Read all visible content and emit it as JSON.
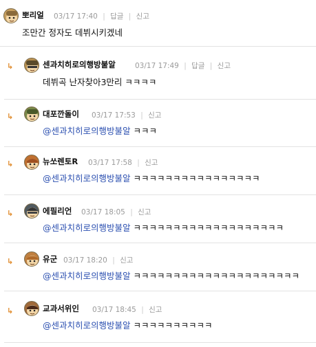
{
  "comments": [
    {
      "author": "뽀리얼",
      "time": "03/17 17:40",
      "reply_label": "답글",
      "report_label": "신고",
      "text": "조만간 정자도 데뷔시키겠네",
      "mention": "",
      "avatar_color": "#c8a060"
    },
    {
      "author": "센과치히로의행방불알",
      "time": "03/17 17:49",
      "reply_label": "답글",
      "report_label": "신고",
      "text": "데뷔곡 난자찾아3만리 ㅋㅋㅋㅋ",
      "mention": "",
      "avatar_color": "#b89050"
    },
    {
      "author": "대포깐돌이",
      "time": "03/17 17:53",
      "report_label": "신고",
      "mention": "@센과치히로의행방불알",
      "text": "ㅋㅋㅋ",
      "avatar_color": "#7a8a4a"
    },
    {
      "author": "뉴쏘렌토R",
      "time": "03/17 17:58",
      "report_label": "신고",
      "mention": "@센과치히로의행방불알",
      "text": "ㅋㅋㅋㅋㅋㅋㅋㅋㅋㅋㅋㅋㅋㅋㅋㅋ",
      "avatar_color": "#c07030"
    },
    {
      "author": "에필리언",
      "time": "03/17 18:05",
      "report_label": "신고",
      "mention": "@센과치히로의행방불알",
      "text": "ㅋㅋㅋㅋㅋㅋㅋㅋㅋㅋㅋㅋㅋㅋㅋㅋㅋㅋㅋ",
      "avatar_color": "#505a60"
    },
    {
      "author": "유군",
      "time": "03/17 18:20",
      "report_label": "신고",
      "mention": "@센과치히로의행방불알",
      "text": "ㅋㅋㅋㅋㅋㅋㅋㅋㅋㅋㅋㅋㅋㅋㅋㅋㅋㅋㅋㅋㅋ",
      "avatar_color": "#c08040"
    },
    {
      "author": "교과서위인",
      "time": "03/17 18:45",
      "report_label": "신고",
      "mention": "@센과치히로의행방불알",
      "text": "ㅋㅋㅋㅋㅋㅋㅋㅋㅋㅋ",
      "avatar_color": "#a06a3a"
    }
  ],
  "reply_arrow": "↳",
  "colors": {
    "mention": "#2b4fb0",
    "meta": "#9a9a9a",
    "arrow": "#e08a2a",
    "divider": "#e2e2e2"
  }
}
